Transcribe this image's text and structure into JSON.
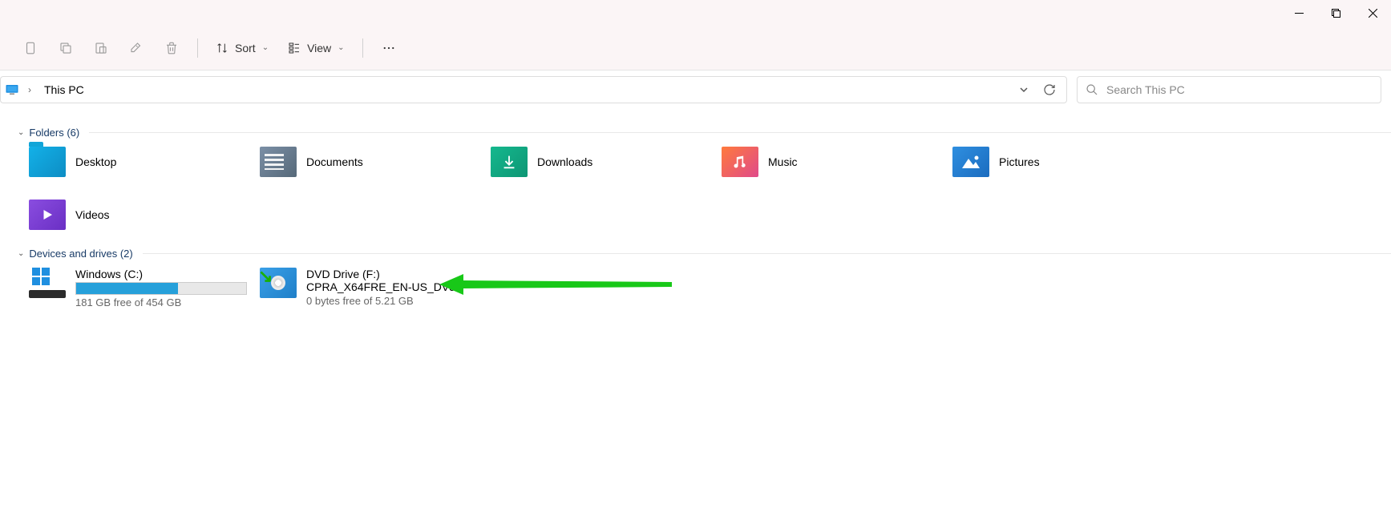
{
  "window": {
    "location": "This PC"
  },
  "toolbar": {
    "sort_label": "Sort",
    "view_label": "View"
  },
  "search": {
    "placeholder": "Search This PC"
  },
  "groups": {
    "folders": {
      "header": "Folders (6)"
    },
    "drives": {
      "header": "Devices and drives (2)"
    }
  },
  "folders": [
    {
      "label": "Desktop"
    },
    {
      "label": "Documents"
    },
    {
      "label": "Downloads"
    },
    {
      "label": "Music"
    },
    {
      "label": "Pictures"
    },
    {
      "label": "Videos"
    }
  ],
  "drives": {
    "c": {
      "name": "Windows (C:)",
      "free": "181 GB free of 454 GB",
      "fill_percent": 60
    },
    "dvd": {
      "name": "DVD Drive (F:)",
      "label": "CPRA_X64FRE_EN-US_DV5",
      "free": "0 bytes free of 5.21 GB"
    }
  }
}
